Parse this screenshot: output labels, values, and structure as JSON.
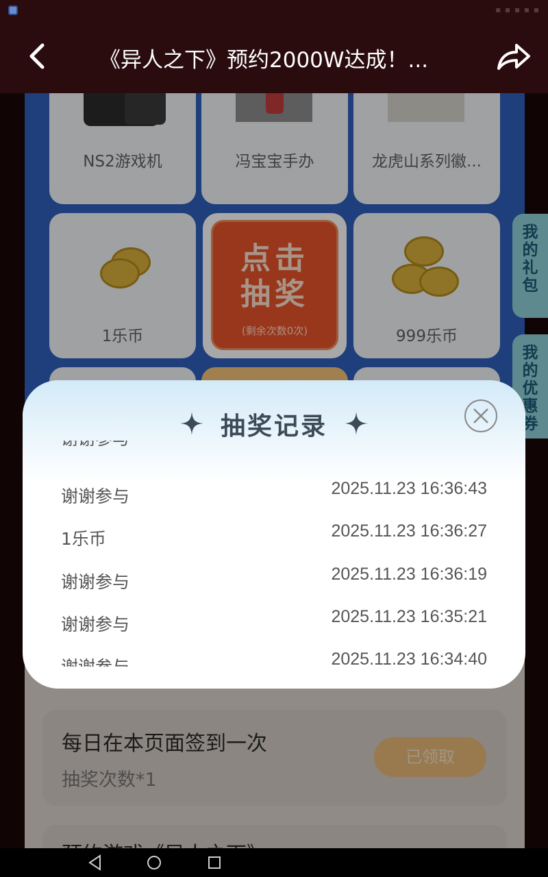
{
  "nav": {
    "title": "《异人之下》预约2000W达成！..."
  },
  "prizes": [
    {
      "label": "NS2游戏机"
    },
    {
      "label": "冯宝宝手办"
    },
    {
      "label": "龙虎山系列徽..."
    },
    {
      "label": "1乐币"
    },
    {
      "label": "999乐币"
    }
  ],
  "draw": {
    "label_line1": "点击",
    "label_line2": "抽奖",
    "remaining": "(剩余次数0次)"
  },
  "side_tabs": {
    "gift": "我的礼包",
    "coupon": "我的优惠券"
  },
  "tasks": [
    {
      "title": "每日在本页面签到一次",
      "sub": "抽奖次数*1",
      "button": "已领取"
    },
    {
      "title": "预约游戏《异人之下》"
    }
  ],
  "modal": {
    "title": "抽奖记录",
    "records": [
      {
        "prize": "谢谢参与",
        "time": ""
      },
      {
        "prize": "谢谢参与",
        "time": "2025.11.23 16:36:43"
      },
      {
        "prize": "1乐币",
        "time": "2025.11.23 16:36:27"
      },
      {
        "prize": "谢谢参与",
        "time": "2025.11.23 16:36:19"
      },
      {
        "prize": "谢谢参与",
        "time": "2025.11.23 16:35:21"
      },
      {
        "prize": "谢谢参与",
        "time": "2025.11.23 16:34:40"
      }
    ]
  },
  "colors": {
    "nav_bg": "#2a0c0f",
    "board_blue": "#2e5fbd",
    "draw_orange": "#e8542c",
    "claim_gold": "#e9b877"
  }
}
